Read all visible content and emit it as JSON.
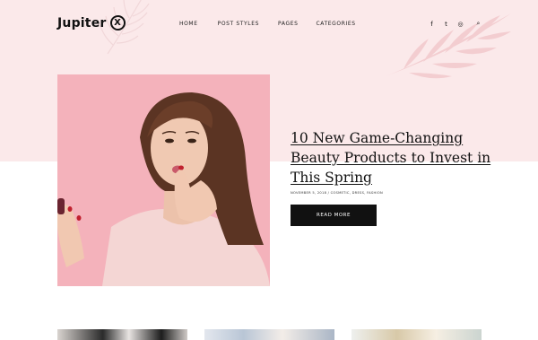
{
  "brand": {
    "name": "Jupiter",
    "mark": "X"
  },
  "nav": {
    "items": [
      "HOME",
      "POST STYLES",
      "PAGES",
      "CATEGORIES"
    ]
  },
  "social": {
    "icons": [
      "facebook-icon",
      "twitter-icon",
      "instagram-icon",
      "search-icon"
    ],
    "glyphs": [
      "f",
      "t",
      "◎",
      "⌕"
    ]
  },
  "featured_post": {
    "title": "10 New Game-Changing Beauty Products to Invest in This Spring",
    "meta": "NOVEMBER 5, 2018 / COSMETIC, DRESS, FASHION",
    "cta": "READ MORE"
  },
  "colors": {
    "hero_band": "#fbe9ea",
    "photo_bg": "#f4b2bb",
    "button_bg": "#111111"
  }
}
